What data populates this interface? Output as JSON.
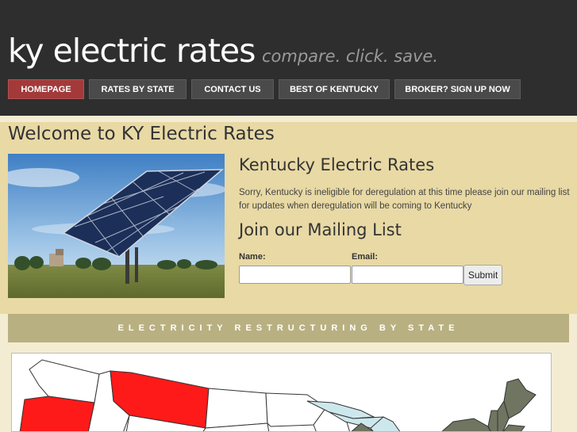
{
  "brand": {
    "title": "ky electric rates",
    "tagline": "compare. click. save."
  },
  "nav": {
    "items": [
      {
        "label": "HOMEPAGE",
        "active": true
      },
      {
        "label": "RATES BY STATE",
        "active": false
      },
      {
        "label": "CONTACT US",
        "active": false
      },
      {
        "label": "BEST OF KENTUCKY",
        "active": false
      },
      {
        "label": "BROKER? SIGN UP NOW",
        "active": false
      }
    ]
  },
  "welcome": {
    "title": "Welcome to KY Electric Rates"
  },
  "kentucky": {
    "heading": "Kentucky Electric Rates",
    "text": "Sorry, Kentucky is ineligible for deregulation at this time please join our mailing list for updates when deregulation will be coming to Kentucky"
  },
  "mailing": {
    "heading": "Join our Mailing List",
    "name_label": "Name:",
    "email_label": "Email:",
    "name_value": "",
    "email_value": "",
    "submit_label": "Submit"
  },
  "restructuring": {
    "title": "ELECTRICITY RESTRUCTURING BY STATE"
  },
  "colors": {
    "header_bg": "#2e2e2e",
    "nav_active": "#a23a3a",
    "panel_bg": "#e8d9a5",
    "section_bar": "#b9b082",
    "map_dereg": "#ff1a1a",
    "map_partial": "#6f7560",
    "map_lake": "#cde8ec"
  }
}
